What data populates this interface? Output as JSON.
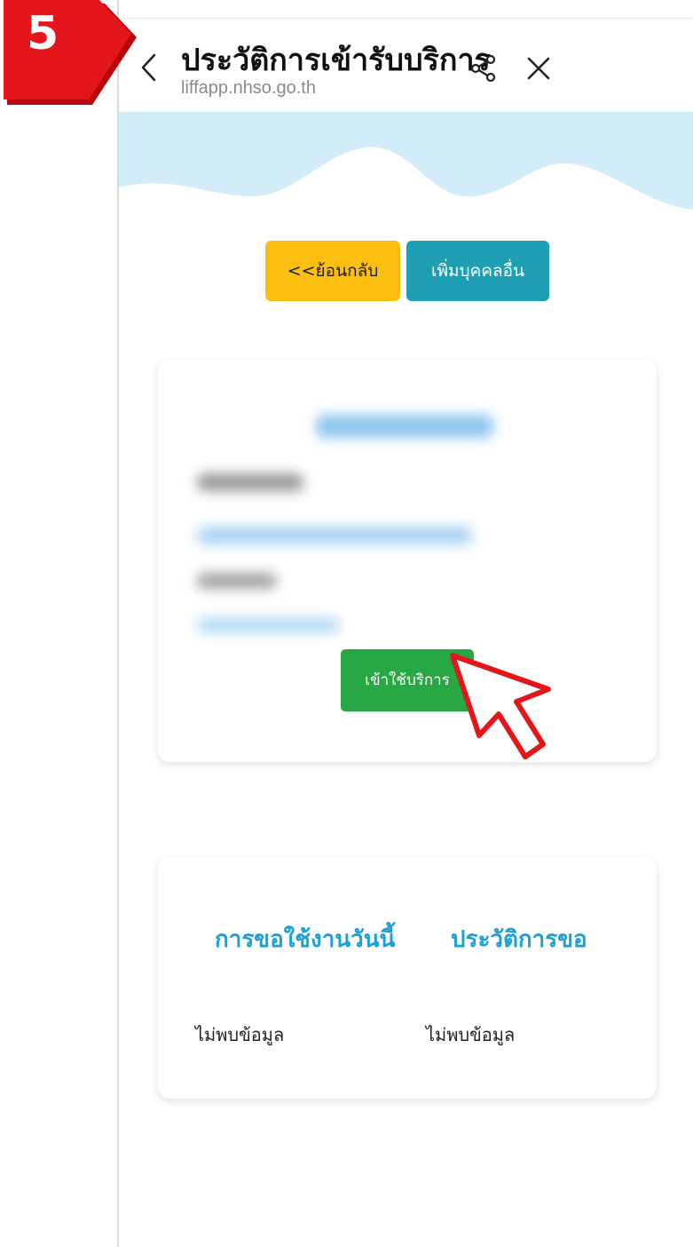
{
  "step": {
    "number": "5",
    "color": "#e4151b",
    "icon": "step-badge-arrow"
  },
  "header": {
    "title": "ประวัติการเข้ารับบริการ",
    "url": "liffapp.nhso.go.th",
    "back_icon": "chevron-left-icon",
    "share_icon": "share-icon",
    "close_icon": "close-icon"
  },
  "banner": {
    "color": "#d3ecfa"
  },
  "actions": {
    "back_label": "<<ย้อนกลับ",
    "back_color": "#fcbf0f",
    "add_person_label": "เพิ่มบุคคลอื่น",
    "add_person_color": "#1f9fb3"
  },
  "service_card": {
    "service_button_label": "เข้าใช้บริการ",
    "service_button_color": "#27a844"
  },
  "requests_card": {
    "today_heading": "การขอใช้งานวันนี้",
    "history_heading": "ประวัติการขอ",
    "today_empty_text": "ไม่พบข้อมูล",
    "history_empty_text": "ไม่พบข้อมูล",
    "heading_color": "#1ba0d8"
  },
  "pointer": {
    "icon": "cursor-arrow-icon",
    "color": "#e4151b"
  }
}
